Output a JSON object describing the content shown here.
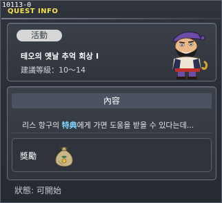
{
  "window": {
    "quest_id": "10113-0",
    "title": "QUEST INFO"
  },
  "summary": {
    "category_badge": "活動",
    "quest_title": "테오의 옛날 추억 회상 I",
    "level_req": "建議等級：10～14"
  },
  "content": {
    "header": "內容",
    "description_before": "리스 항구의 ",
    "description_highlight": "特典",
    "description_after": "에게 가면 도움을 받을 수 있다는데...",
    "reward_label": "獎勵"
  },
  "footer": {
    "status": "狀態:  可開始"
  },
  "colors": {
    "title_yellow": "#f5e24a",
    "highlight_blue": "#7fd6ff",
    "panel_bg": "#3b4049"
  },
  "icons": {
    "npc": "pirate-npc-portrait",
    "reward": "money-bag-icon"
  }
}
